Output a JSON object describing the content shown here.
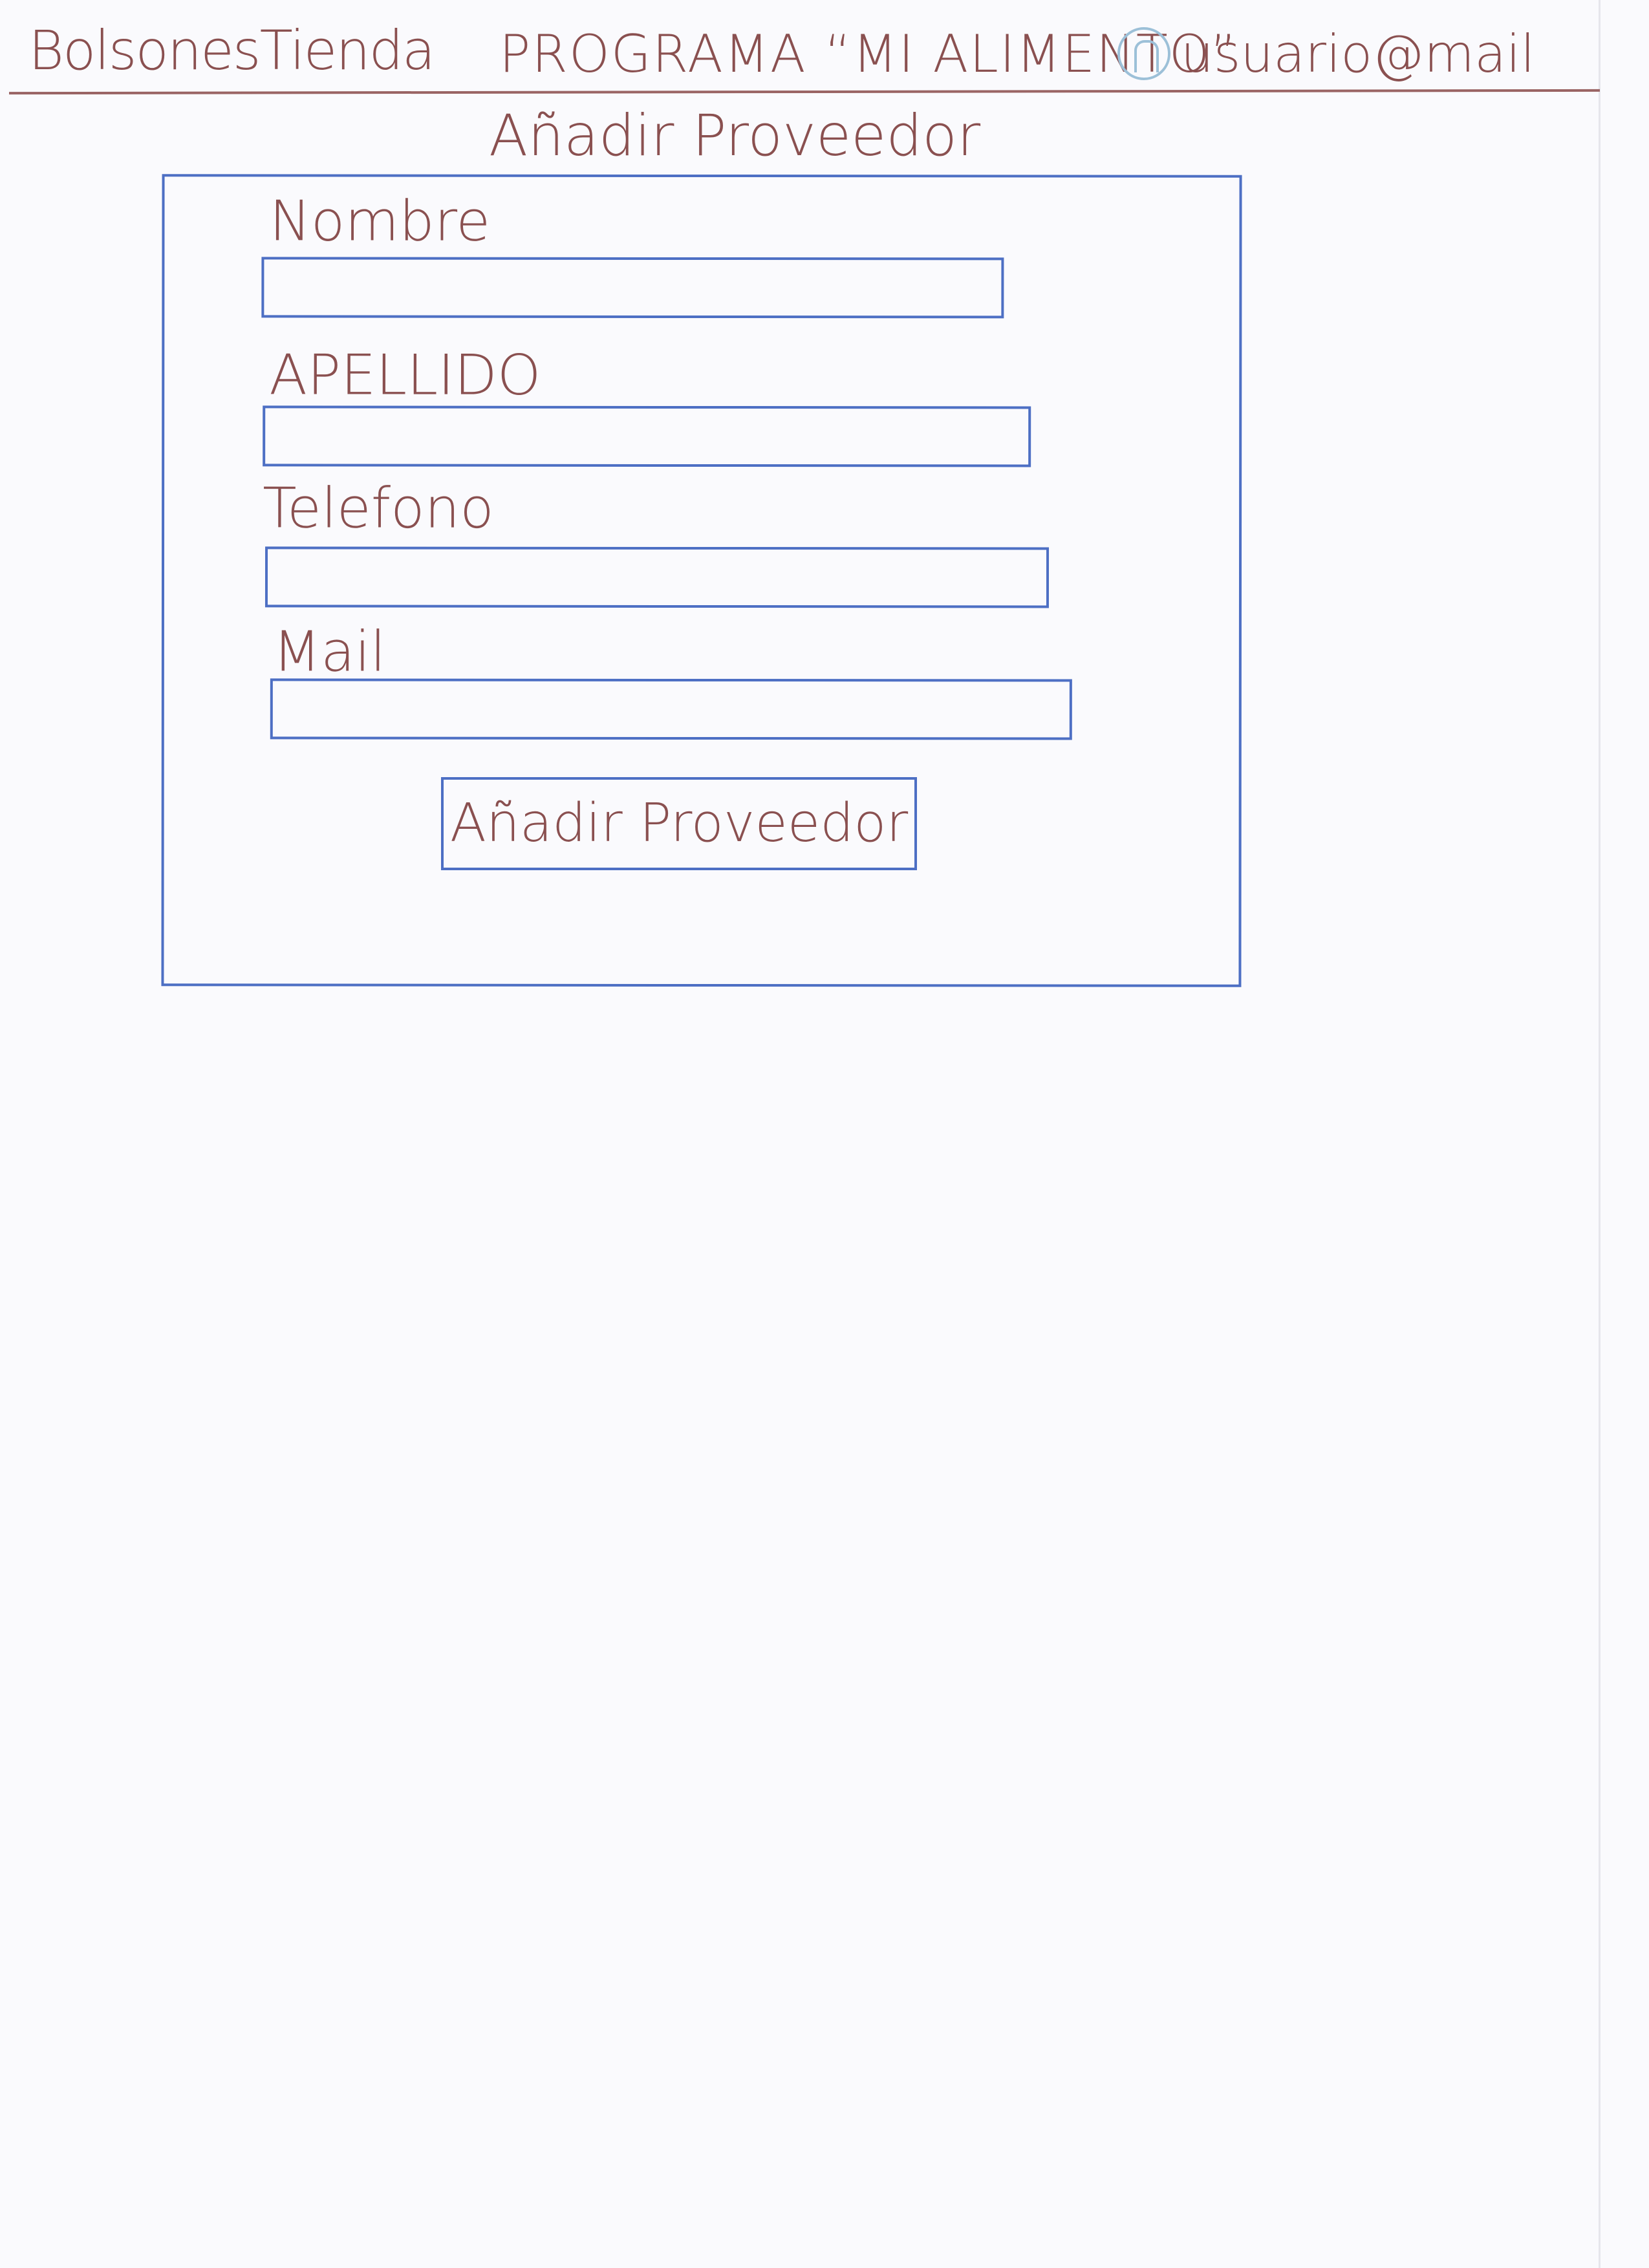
{
  "header": {
    "brand": "BolsonesTienda",
    "program": "PROGRAMA “MI ALIMENTO”",
    "user_icon": "user-icon",
    "user_email": "usuario@mail"
  },
  "page": {
    "title": "Añadir Proveedor"
  },
  "form": {
    "fields": [
      {
        "label": "Nombre",
        "value": ""
      },
      {
        "label": "APELLIDO",
        "value": ""
      },
      {
        "label": "Telefono",
        "value": ""
      },
      {
        "label": "Mail",
        "value": ""
      }
    ],
    "submit_label": "Añadir Proveedor"
  },
  "colors": {
    "ink_text": "#8a5050",
    "ink_boxes": "#4d6fc4",
    "icon": "#9cc0d8"
  }
}
